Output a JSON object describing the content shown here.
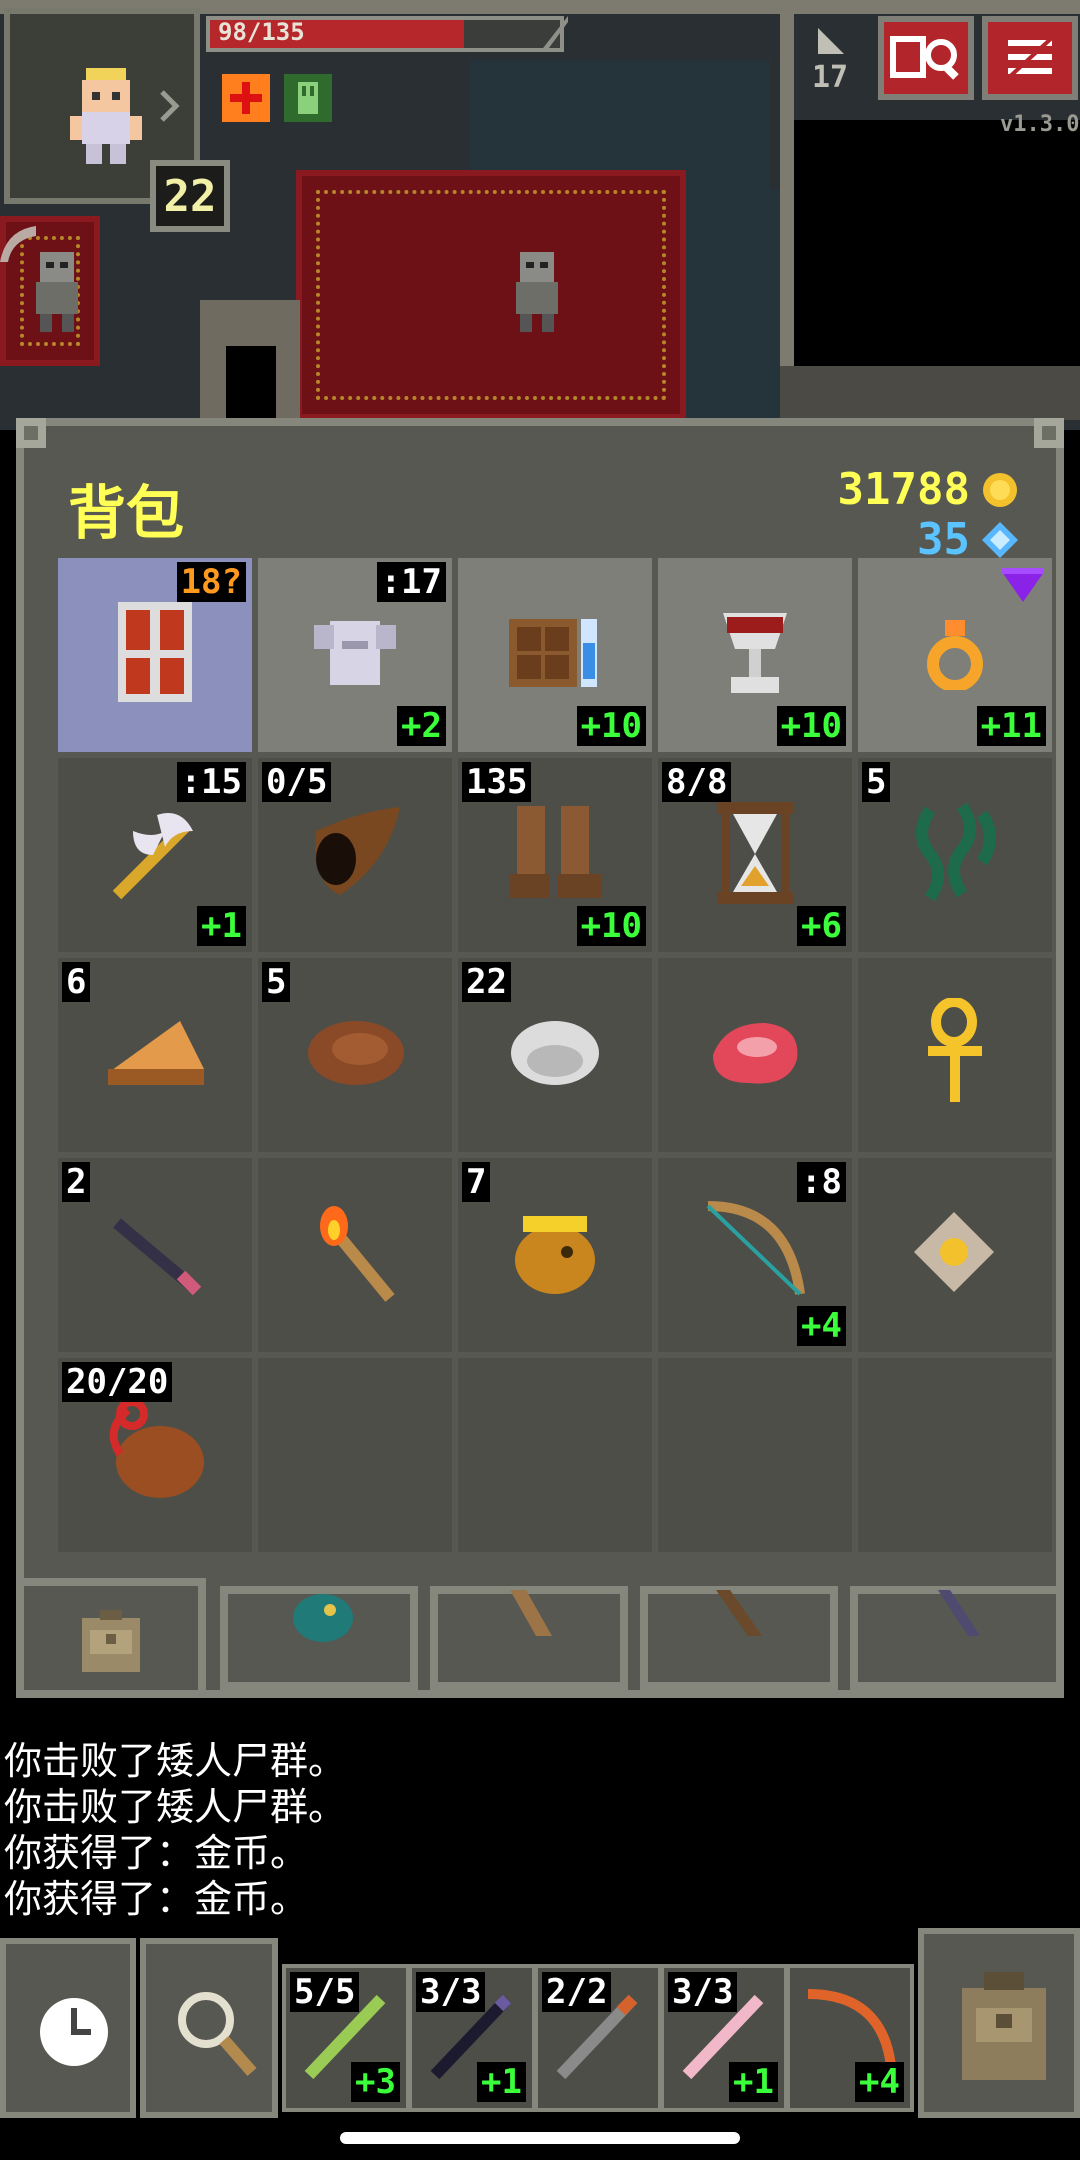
{
  "hud": {
    "hp": "98/135",
    "hp_fraction": 0.726,
    "level": "22",
    "depth": "17",
    "version": "v1.3.0",
    "buffs": [
      "regeneration-buff-icon",
      "barkskin-buff-icon"
    ],
    "hp_color": "#b6272b"
  },
  "inventory": {
    "title": "背包",
    "gold": "31788",
    "gems": "35",
    "slots": [
      {
        "icon": "shield-armor-icon",
        "qty": "18?",
        "qty_pos": "tr",
        "qty_color": "orange",
        "level": "",
        "selected": true
      },
      {
        "icon": "plate-armor-icon",
        "qty": ":17",
        "qty_pos": "tr",
        "level": "+2",
        "light": true
      },
      {
        "icon": "spellbook-icon",
        "qty": "",
        "level": "+10",
        "light": true
      },
      {
        "icon": "chalice-icon",
        "qty": "",
        "level": "+10",
        "light": true
      },
      {
        "icon": "ring-icon",
        "qty": "",
        "level": "+11",
        "light": true,
        "badge": "purple-gem"
      },
      {
        "icon": "battle-axe-icon",
        "qty": ":15",
        "qty_pos": "tr",
        "level": "+1"
      },
      {
        "icon": "horn-icon",
        "qty": "0/5",
        "qty_pos": "tl",
        "level": ""
      },
      {
        "icon": "boots-icon",
        "qty": "135",
        "qty_pos": "tl",
        "level": "+10"
      },
      {
        "icon": "hourglass-icon",
        "qty": "8/8",
        "qty_pos": "tl",
        "level": "+6"
      },
      {
        "icon": "chain-icon",
        "qty": "5",
        "qty_pos": "tl",
        "level": ""
      },
      {
        "icon": "pie-icon",
        "qty": "6",
        "qty_pos": "tl",
        "level": ""
      },
      {
        "icon": "steak-icon",
        "qty": "5",
        "qty_pos": "tl",
        "level": ""
      },
      {
        "icon": "mushroom-icon",
        "qty": "22",
        "qty_pos": "tl",
        "level": ""
      },
      {
        "icon": "raw-meat-icon",
        "qty": "",
        "level": ""
      },
      {
        "icon": "ankh-icon",
        "qty": "",
        "level": ""
      },
      {
        "icon": "dart-icon",
        "qty": "2",
        "qty_pos": "tl",
        "level": ""
      },
      {
        "icon": "torch-icon",
        "qty": "",
        "level": ""
      },
      {
        "icon": "honey-pot-icon",
        "qty": "7",
        "qty_pos": "tl",
        "level": ""
      },
      {
        "icon": "bow-icon",
        "qty": ":8",
        "qty_pos": "tr",
        "level": "+4"
      },
      {
        "icon": "amulet-icon",
        "qty": "",
        "level": ""
      },
      {
        "icon": "waterskin-icon",
        "qty": "20/20",
        "qty_pos": "tl",
        "level": ""
      },
      {
        "icon": "",
        "qty": "",
        "level": ""
      },
      {
        "icon": "",
        "qty": "",
        "level": ""
      },
      {
        "icon": "",
        "qty": "",
        "level": ""
      },
      {
        "icon": "",
        "qty": "",
        "level": ""
      }
    ]
  },
  "log": [
    "你击败了矮人尸群。",
    "你击败了矮人尸群。",
    "你获得了：金币。",
    "你获得了：金币。"
  ],
  "quickslots": [
    {
      "icon": "green-wand-icon",
      "qty": "5/5",
      "level": "+3"
    },
    {
      "icon": "dark-wand-icon",
      "qty": "3/3",
      "level": "+1"
    },
    {
      "icon": "grey-wand-icon",
      "qty": "2/2",
      "level": ""
    },
    {
      "icon": "pink-wand-icon",
      "qty": "3/3",
      "level": "+1"
    },
    {
      "icon": "orange-bow-icon",
      "qty": "",
      "level": "+4"
    }
  ]
}
